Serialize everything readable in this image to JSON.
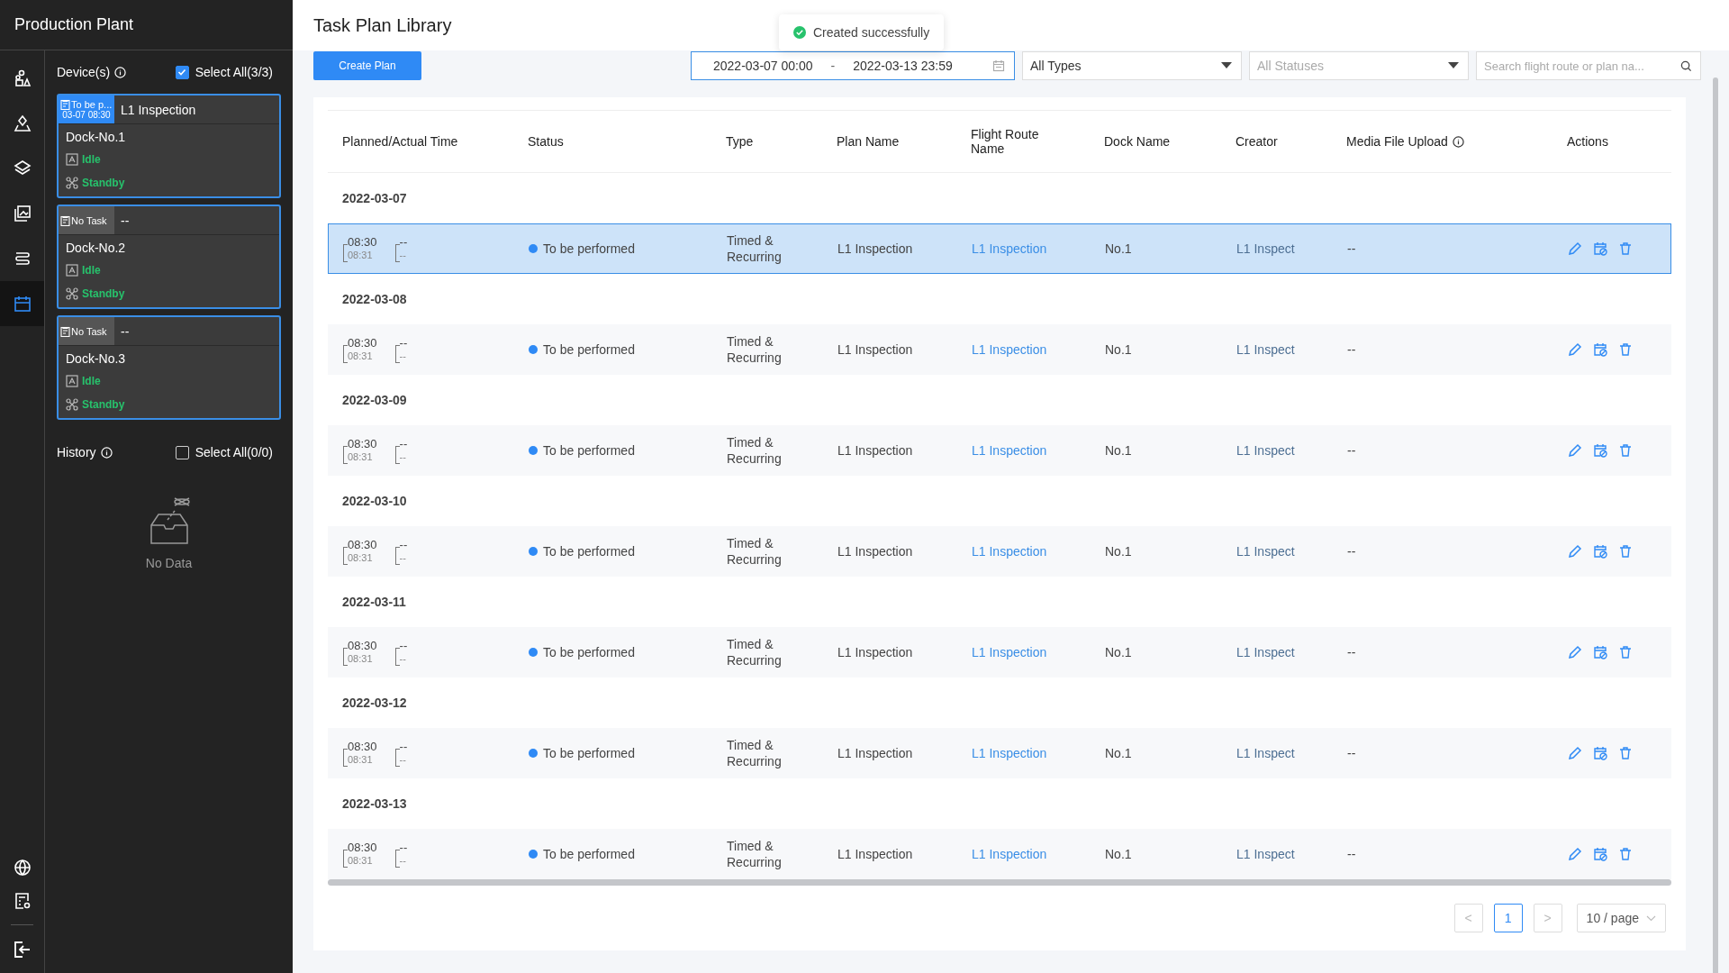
{
  "sidebar": {
    "title": "Production Plant",
    "rail": [
      {
        "selected": false
      },
      {
        "selected": false
      },
      {
        "selected": false
      },
      {
        "selected": false
      },
      {
        "selected": false
      },
      {
        "selected": true
      }
    ],
    "devices": {
      "label": "Device(s)",
      "select_all": {
        "label": "Select All(3/3)",
        "checked": true
      },
      "items": [
        {
          "task_status": "To be p...",
          "task_time": "03-07 08:30",
          "task_active": true,
          "task_name": "L1 Inspection",
          "name": "Dock-No.1",
          "dock_state": "Idle",
          "drone_state": "Standby"
        },
        {
          "task_status": "No Task",
          "task_active": false,
          "task_name": "--",
          "name": "Dock-No.2",
          "dock_state": "Idle",
          "drone_state": "Standby"
        },
        {
          "task_status": "No Task",
          "task_active": false,
          "task_name": "--",
          "name": "Dock-No.3",
          "dock_state": "Idle",
          "drone_state": "Standby"
        }
      ]
    },
    "history": {
      "label": "History",
      "select_all": {
        "label": "Select All(0/0)",
        "checked": false
      },
      "empty_text": "No Data"
    }
  },
  "main": {
    "title": "Task Plan Library",
    "toast": "Created successfully",
    "toolbar": {
      "create_button": "Create Plan",
      "date_start": "2022-03-07 00:00",
      "date_separator": "-",
      "date_end": "2022-03-13 23:59",
      "type_select": "All Types",
      "status_select": {
        "placeholder": "All Statuses"
      },
      "search": {
        "placeholder": "Search flight route or plan na..."
      }
    },
    "table": {
      "columns": [
        "Planned/Actual Time",
        "Status",
        "Type",
        "Plan Name",
        "Flight Route Name",
        "Dock Name",
        "Creator",
        "Media File Upload",
        "Actions"
      ],
      "groups": [
        {
          "date": "2022-03-07",
          "rows": [
            {
              "planned_start": "08:30",
              "planned_end": "08:31",
              "actual_start": "--",
              "actual_end": "--",
              "status": "To be performed",
              "type": "Timed & Recurring",
              "plan_name": "L1 Inspection",
              "route_name": "L1 Inspection",
              "dock": "No.1",
              "creator": "L1 Inspect",
              "media": "--",
              "selected": true
            }
          ]
        },
        {
          "date": "2022-03-08",
          "rows": [
            {
              "planned_start": "08:30",
              "planned_end": "08:31",
              "actual_start": "--",
              "actual_end": "--",
              "status": "To be performed",
              "type": "Timed & Recurring",
              "plan_name": "L1 Inspection",
              "route_name": "L1 Inspection",
              "dock": "No.1",
              "creator": "L1 Inspect",
              "media": "--",
              "selected": false
            }
          ]
        },
        {
          "date": "2022-03-09",
          "rows": [
            {
              "planned_start": "08:30",
              "planned_end": "08:31",
              "actual_start": "--",
              "actual_end": "--",
              "status": "To be performed",
              "type": "Timed & Recurring",
              "plan_name": "L1 Inspection",
              "route_name": "L1 Inspection",
              "dock": "No.1",
              "creator": "L1 Inspect",
              "media": "--",
              "selected": false
            }
          ]
        },
        {
          "date": "2022-03-10",
          "rows": [
            {
              "planned_start": "08:30",
              "planned_end": "08:31",
              "actual_start": "--",
              "actual_end": "--",
              "status": "To be performed",
              "type": "Timed & Recurring",
              "plan_name": "L1 Inspection",
              "route_name": "L1 Inspection",
              "dock": "No.1",
              "creator": "L1 Inspect",
              "media": "--",
              "selected": false
            }
          ]
        },
        {
          "date": "2022-03-11",
          "rows": [
            {
              "planned_start": "08:30",
              "planned_end": "08:31",
              "actual_start": "--",
              "actual_end": "--",
              "status": "To be performed",
              "type": "Timed & Recurring",
              "plan_name": "L1 Inspection",
              "route_name": "L1 Inspection",
              "dock": "No.1",
              "creator": "L1 Inspect",
              "media": "--",
              "selected": false
            }
          ]
        },
        {
          "date": "2022-03-12",
          "rows": [
            {
              "planned_start": "08:30",
              "planned_end": "08:31",
              "actual_start": "--",
              "actual_end": "--",
              "status": "To be performed",
              "type": "Timed & Recurring",
              "plan_name": "L1 Inspection",
              "route_name": "L1 Inspection",
              "dock": "No.1",
              "creator": "L1 Inspect",
              "media": "--",
              "selected": false
            }
          ]
        },
        {
          "date": "2022-03-13",
          "rows": [
            {
              "planned_start": "08:30",
              "planned_end": "08:31",
              "actual_start": "--",
              "actual_end": "--",
              "status": "To be performed",
              "type": "Timed & Recurring",
              "plan_name": "L1 Inspection",
              "route_name": "L1 Inspection",
              "dock": "No.1",
              "creator": "L1 Inspect",
              "media": "--",
              "selected": false
            }
          ]
        }
      ]
    },
    "pagination": {
      "prev": "<",
      "pages": [
        {
          "label": "1",
          "selected": true
        }
      ],
      "next": ">",
      "page_size": "10 / page"
    }
  }
}
